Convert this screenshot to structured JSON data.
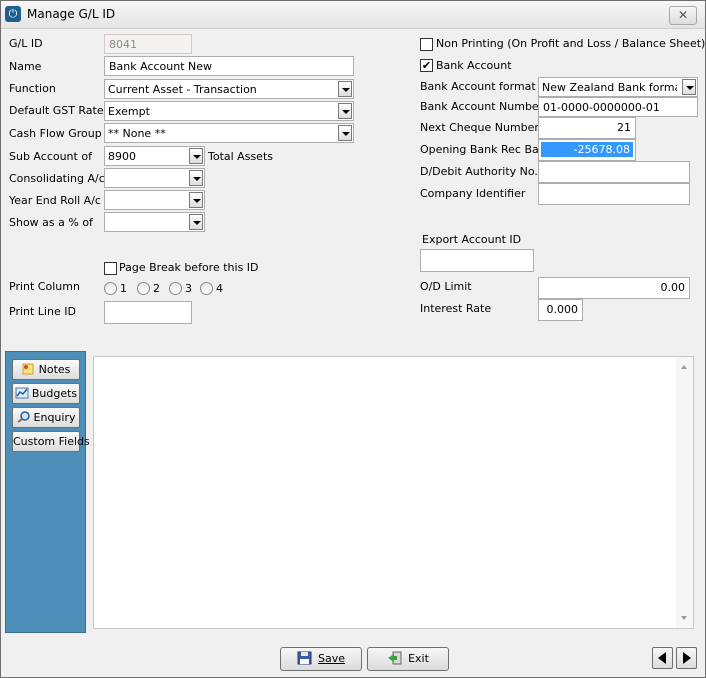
{
  "window": {
    "title": "Manage G/L ID",
    "close_glyph": "✕"
  },
  "form": {
    "gl_id": {
      "label": "G/L ID",
      "value": "8041"
    },
    "name": {
      "label": "Name",
      "value": "Bank Account New"
    },
    "function": {
      "label": "Function",
      "value": "Current Asset - Transaction"
    },
    "gst_rate": {
      "label": "Default GST Rate",
      "value": "Exempt"
    },
    "cash_flow": {
      "label": "Cash Flow Group",
      "value": "** None **"
    },
    "sub_account": {
      "label": "Sub Account of",
      "value": "8900",
      "desc": "Total Assets"
    },
    "consolidating": {
      "label": "Consolidating A/c",
      "value": ""
    },
    "year_end_roll": {
      "label": "Year End Roll A/c",
      "value": ""
    },
    "show_pct": {
      "label": "Show as a % of",
      "value": ""
    },
    "page_break": {
      "label": "Page Break before this ID",
      "checked": false
    },
    "print_column": {
      "label": "Print Column",
      "options": [
        "1",
        "2",
        "3",
        "4"
      ]
    },
    "print_line_id": {
      "label": "Print Line ID",
      "value": ""
    }
  },
  "bank": {
    "non_printing": {
      "label": "Non Printing (On Profit and Loss / Balance Sheet)",
      "checked": false
    },
    "bank_account": {
      "label": "Bank Account",
      "checked": true
    },
    "format": {
      "label": "Bank Account format",
      "value": "New Zealand Bank format"
    },
    "number": {
      "label": "Bank Account Number",
      "value": "01-0000-0000000-01"
    },
    "next_cheque": {
      "label": "Next Cheque Number",
      "value": "21"
    },
    "opening_bal": {
      "label": "Opening Bank Rec Bal",
      "value": "-25678.08"
    },
    "ddebit": {
      "label": "D/Debit Authority No.",
      "value": ""
    },
    "company_id": {
      "label": "Company Identifier",
      "value": ""
    },
    "export_id": {
      "label": "Export Account ID",
      "value": ""
    },
    "od_limit": {
      "label": "O/D Limit",
      "value": "0.00"
    },
    "interest": {
      "label": "Interest Rate",
      "value": "0.000"
    }
  },
  "side": {
    "notes": "Notes",
    "budgets": "Budgets",
    "enquiry": "Enquiry",
    "custom": "Custom Fields"
  },
  "footer": {
    "save": "Save",
    "exit": "Exit"
  },
  "colors": {
    "panel": "#4e8fba",
    "selection": "#3399ff"
  }
}
